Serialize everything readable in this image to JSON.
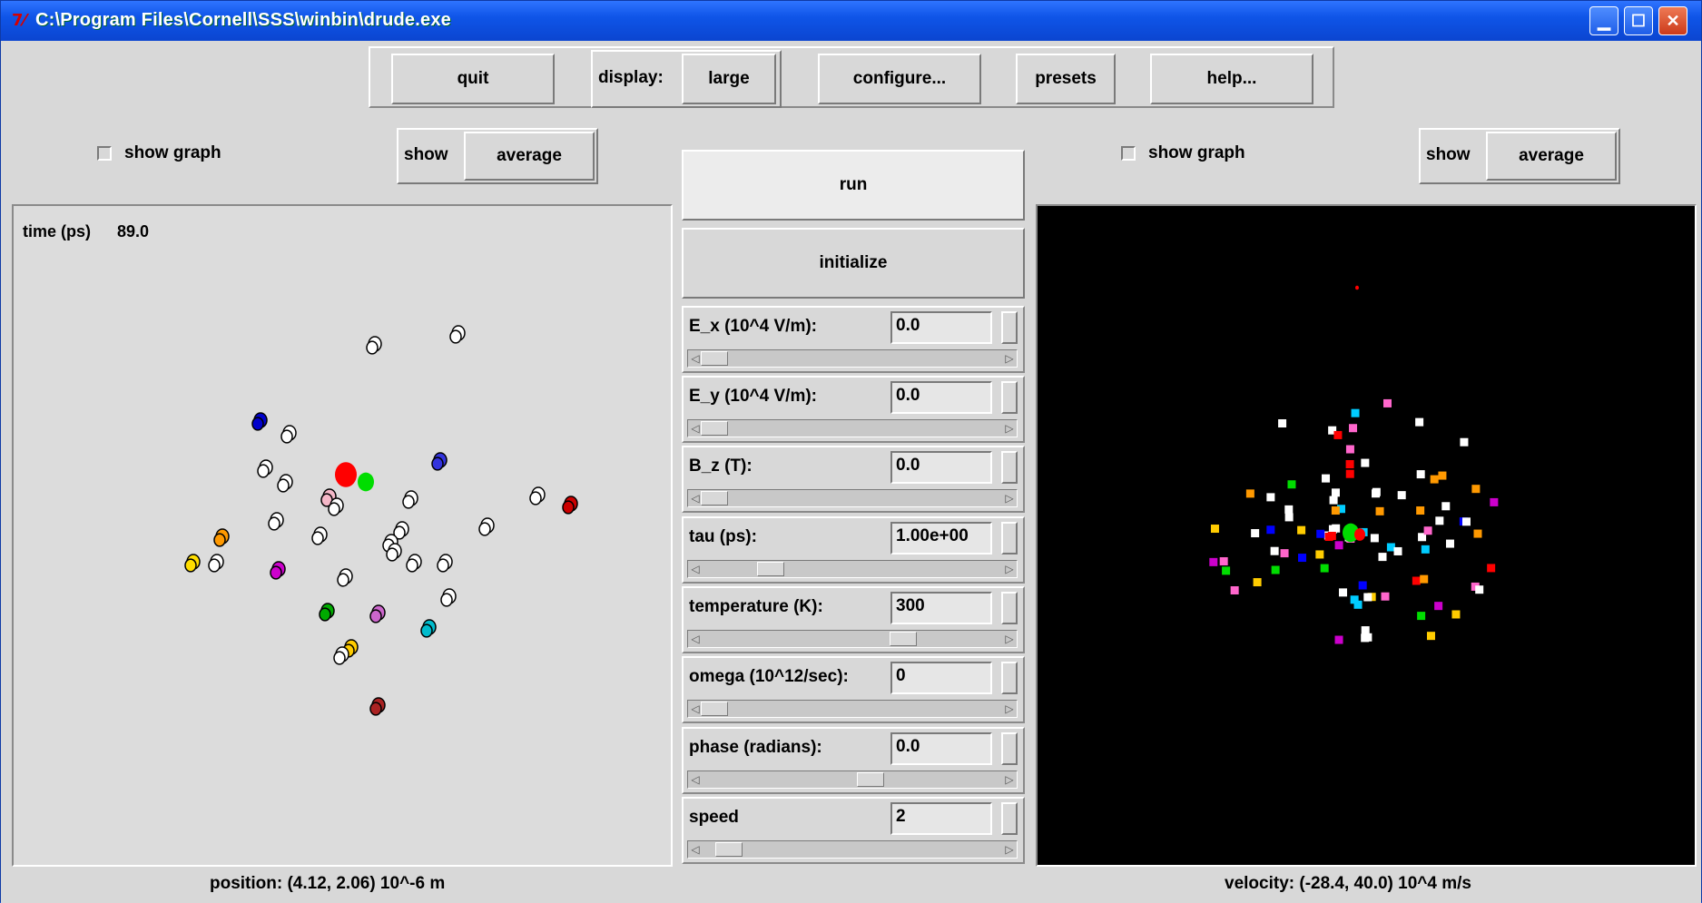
{
  "window": {
    "title": "C:\\Program Files\\Cornell\\SSS\\winbin\\drude.exe",
    "icon": "tk-feather-icon"
  },
  "toolbar": {
    "quit": "quit",
    "display_label": "display:",
    "display_value": "large",
    "configure": "configure...",
    "presets": "presets",
    "help": "help..."
  },
  "left": {
    "show_graph": "show graph",
    "show_label": "show",
    "show_value": "average",
    "time_label": "time (ps)",
    "time_value": "89.0",
    "status": "position: (4.12, 2.06) 10^-6 m"
  },
  "right": {
    "show_graph": "show graph",
    "show_label": "show",
    "show_value": "average",
    "status": "velocity: (-28.4, 40.0) 10^4 m/s"
  },
  "center": {
    "run": "run",
    "initialize": "initialize",
    "controls": [
      {
        "label": "E_x (10^4 V/m):",
        "value": "0.0"
      },
      {
        "label": "E_y (10^4 V/m):",
        "value": "0.0"
      },
      {
        "label": "B_z (T):",
        "value": "0.0"
      },
      {
        "label": "tau (ps):",
        "value": "1.00e+00"
      },
      {
        "label": "temperature (K):",
        "value": "300"
      },
      {
        "label": "omega (10^12/sec):",
        "value": "0"
      },
      {
        "label": "phase (radians):",
        "value": "0.0"
      },
      {
        "label": "speed",
        "value": "2"
      }
    ]
  },
  "colors": {
    "titlebar": "#0f55e8",
    "panel_bg": "#dcdcdc",
    "velocity_bg": "#000000",
    "highlight": "#ff0000",
    "avg": "#00dd00"
  }
}
